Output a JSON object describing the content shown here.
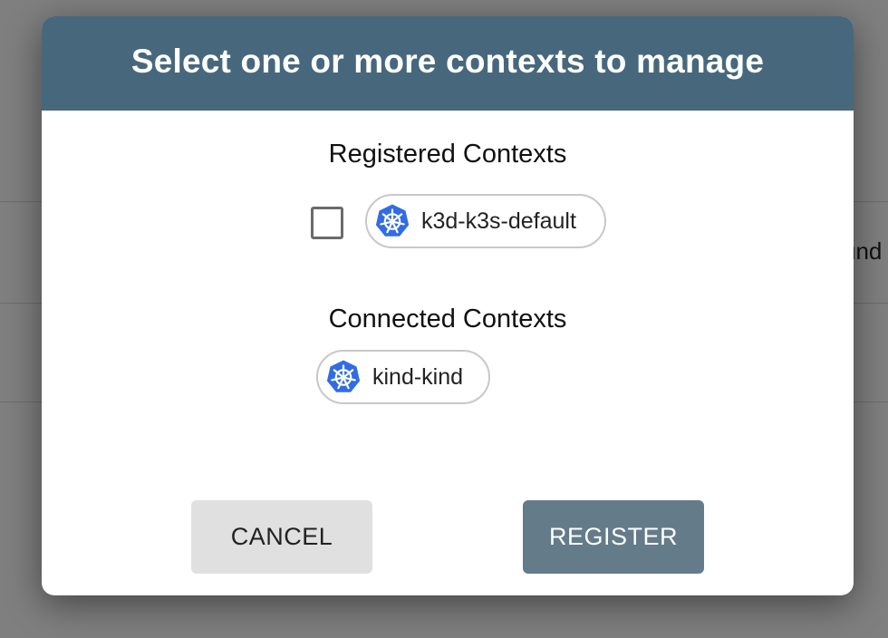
{
  "background": {
    "partial_text": "und"
  },
  "dialog": {
    "title": "Select one or more contexts to manage",
    "registered": {
      "heading": "Registered Contexts",
      "contexts": [
        {
          "label": "k3d-k3s-default",
          "checked": false,
          "icon": "kubernetes-icon"
        }
      ]
    },
    "connected": {
      "heading": "Connected Contexts",
      "contexts": [
        {
          "label": "kind-kind",
          "icon": "kubernetes-icon"
        }
      ]
    },
    "buttons": {
      "cancel_label": "CANCEL",
      "register_label": "REGISTER"
    }
  },
  "colors": {
    "header": "#47687c",
    "register_button": "#647b89",
    "cancel_button": "#e0e0e0",
    "kubernetes_blue": "#326ce5"
  }
}
